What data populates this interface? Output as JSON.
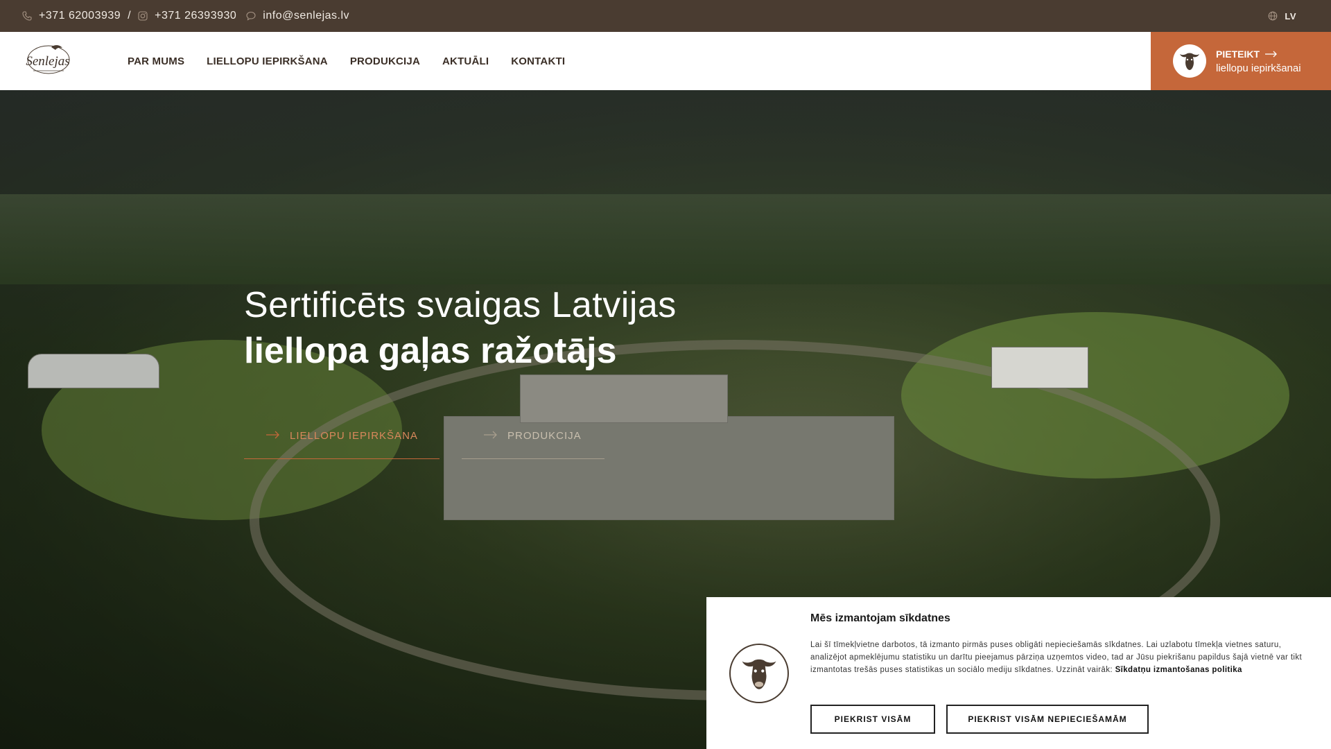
{
  "topbar": {
    "phone1": "+371 62003939",
    "separator": "/",
    "phone2": "+371 26393930",
    "email": "info@senlejas.lv",
    "language": "LV"
  },
  "header": {
    "logo_text": "Senlejas",
    "nav": [
      "PAR MUMS",
      "LIELLOPU IEPIRKŠANA",
      "PRODUKCIJA",
      "AKTUĀLI",
      "KONTAKTI"
    ],
    "cta_title": "PIETEIKT",
    "cta_subtitle": "liellopu iepirkšanai"
  },
  "hero": {
    "line1": "Sertificēts svaigas Latvijas",
    "line2": "liellopa gaļas ražotājs",
    "link1": "LIELLOPU IEPIRKŠANA",
    "link2": "PRODUKCIJA"
  },
  "cookie": {
    "title": "Mēs izmantojam sīkdatnes",
    "text": "Lai šī tīmekļvietne darbotos, tā izmanto pirmās puses obligāti nepieciešamās sīkdatnes. Lai uzlabotu tīmekļa vietnes saturu, analizējot apmeklējumu statistiku un darītu pieejamus pārziņa uzņemtos video, tad ar Jūsu piekrišanu papildus šajā vietnē var tikt izmantotas trešās puses statistikas un sociālo mediju sīkdatnes. Uzzināt vairāk:",
    "policy_link": "Sīkdatņu izmantošanas politika",
    "accept_all": "PIEKRIST VISĀM",
    "accept_necessary": "PIEKRIST VISĀM NEPIECIEŠAMĀM"
  },
  "colors": {
    "topbar_bg": "#4a3c31",
    "accent": "#c5673a",
    "nav_text": "#3a2e26"
  },
  "icons": [
    "phone-icon",
    "instagram-icon",
    "chat-icon",
    "globe-icon",
    "arrow-right-icon",
    "bull-logo-icon"
  ]
}
